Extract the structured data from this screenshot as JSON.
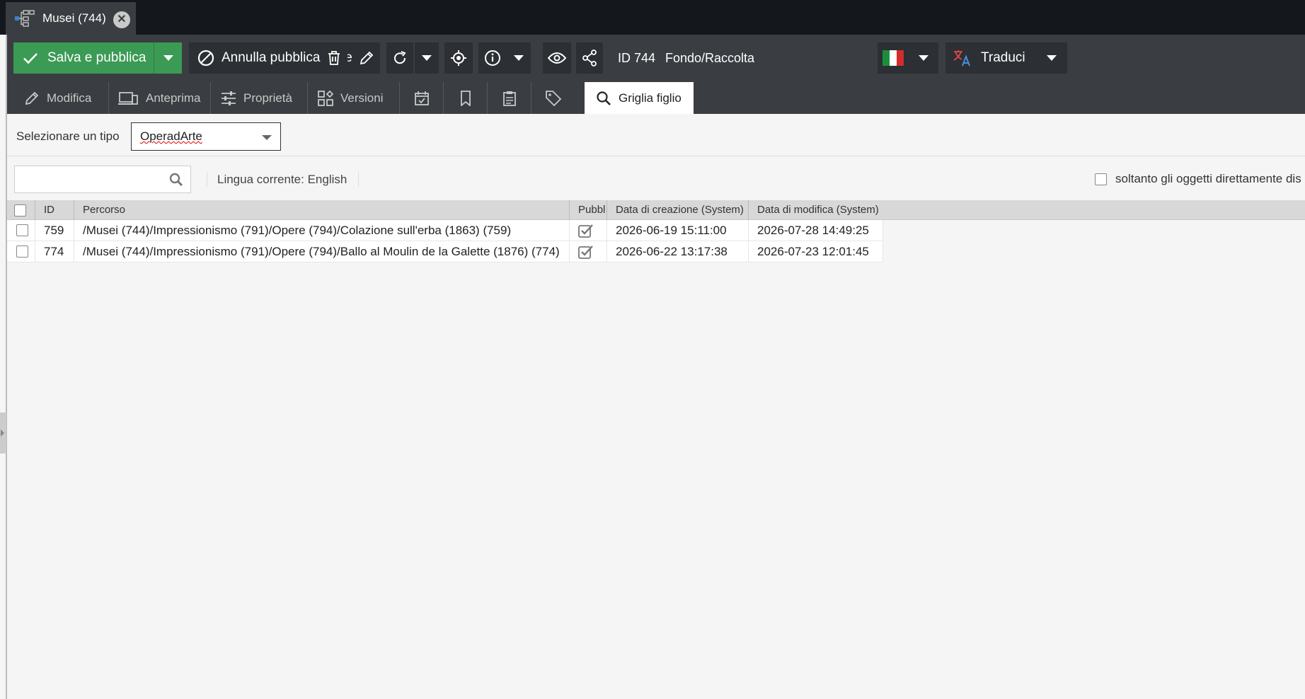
{
  "tab": {
    "title": "Musei (744)"
  },
  "toolbar": {
    "save_label": "Salva e pubblica",
    "unpublish_label": "Annulla pubblicazione",
    "id_label": "ID 744",
    "class_label": "Fondo/Raccolta",
    "translate_label": "Traduci",
    "save_color": "#3b9a54"
  },
  "subtabs": [
    {
      "label": "Modifica"
    },
    {
      "label": "Anteprima"
    },
    {
      "label": "Proprietà"
    },
    {
      "label": "Versioni"
    },
    {
      "label": "Griglia figlio"
    }
  ],
  "type_selector": {
    "label": "Selezionare un tipo",
    "value": "OperadArte"
  },
  "search": {
    "placeholder": ""
  },
  "language": {
    "text": "Lingua corrente: English"
  },
  "direct_only": {
    "label": "soltanto gli oggetti direttamente dis",
    "checked": false
  },
  "grid": {
    "columns": [
      "ID",
      "Percorso",
      "Pubbl",
      "Data di creazione (System)",
      "Data di modifica (System)"
    ],
    "rows": [
      {
        "id": "759",
        "path": "/Musei (744)/Impressionismo (791)/Opere (794)/Colazione sull'erba (1863) (759)",
        "published": true,
        "created": "2026-06-19 15:11:00",
        "modified": "2026-07-28 14:49:25"
      },
      {
        "id": "774",
        "path": "/Musei (744)/Impressionismo (791)/Opere (794)/Ballo al Moulin de la Galette (1876) (774)",
        "published": true,
        "created": "2026-06-22 13:17:38",
        "modified": "2026-07-23 12:01:45"
      }
    ]
  }
}
